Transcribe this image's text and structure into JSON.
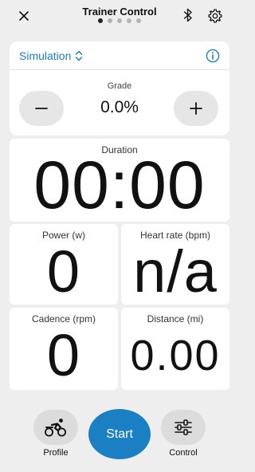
{
  "header": {
    "title": "Trainer Control",
    "page_count": 5,
    "active_page": 1
  },
  "mode": {
    "selected": "Simulation"
  },
  "grade": {
    "label": "Grade",
    "value": "0.0%"
  },
  "metrics": {
    "duration": {
      "label": "Duration",
      "value": "00:00"
    },
    "power": {
      "label": "Power (w)",
      "value": "0"
    },
    "heart_rate": {
      "label": "Heart rate (bpm)",
      "value": "n/a"
    },
    "cadence": {
      "label": "Cadence (rpm)",
      "value": "0"
    },
    "distance": {
      "label": "Distance (mi)",
      "value": "0.00"
    }
  },
  "bottom": {
    "profile_label": "Profile",
    "start_label": "Start",
    "control_label": "Control"
  },
  "colors": {
    "accent": "#1b7fc4",
    "background": "#eeeeee",
    "card": "#ffffff",
    "button_gray": "#e6e6e6"
  },
  "icons": {
    "close": "close-icon",
    "bluetooth": "bluetooth-icon",
    "settings": "gear-icon",
    "info": "info-icon",
    "minus": "minus-icon",
    "plus": "plus-icon",
    "profile": "cyclist-icon",
    "control": "sliders-icon",
    "mode_toggle": "chevron-updown-icon"
  }
}
